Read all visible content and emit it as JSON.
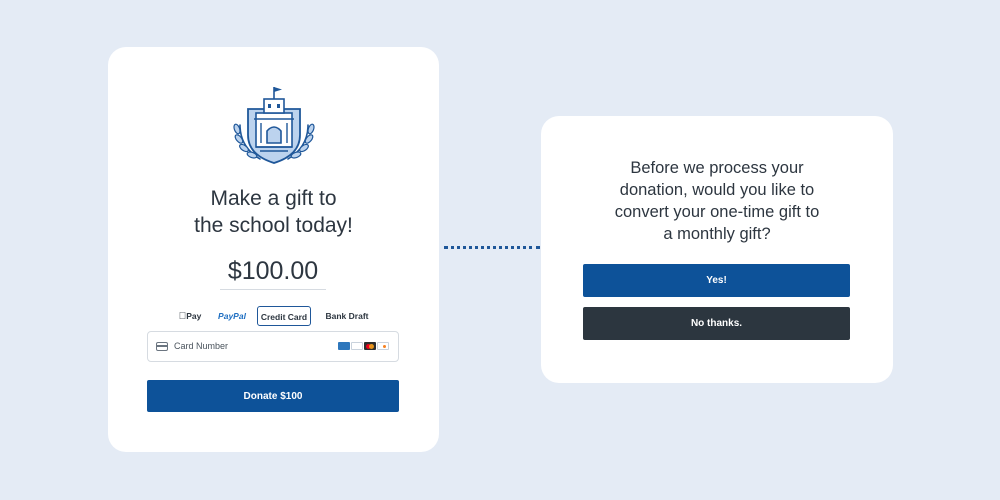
{
  "donation_form": {
    "headline_line1": "Make a gift to",
    "headline_line2": "the school today!",
    "amount": "$100.00",
    "payment_methods": {
      "apple_pay": "Pay",
      "paypal": "PayPal",
      "credit_card": "Credit Card",
      "bank_draft": "Bank Draft"
    },
    "selected_payment_method": "Credit Card",
    "card_number_placeholder": "Card Number",
    "card_brands": [
      "amex-icon",
      "visa-icon",
      "mastercard-icon",
      "discover-icon"
    ],
    "donate_button": "Donate $100"
  },
  "upsell_dialog": {
    "question_line1": "Before we process your",
    "question_line2": "donation, would you like to",
    "question_line3": "convert your one-time gift to",
    "question_line4": "a monthly gift?",
    "yes_button": "Yes!",
    "no_button": "No thanks."
  },
  "colors": {
    "background": "#e4ebf5",
    "primary": "#0d5299",
    "dark": "#2c363f",
    "text": "#2d3640",
    "crest_fill": "#bcd3ee"
  }
}
